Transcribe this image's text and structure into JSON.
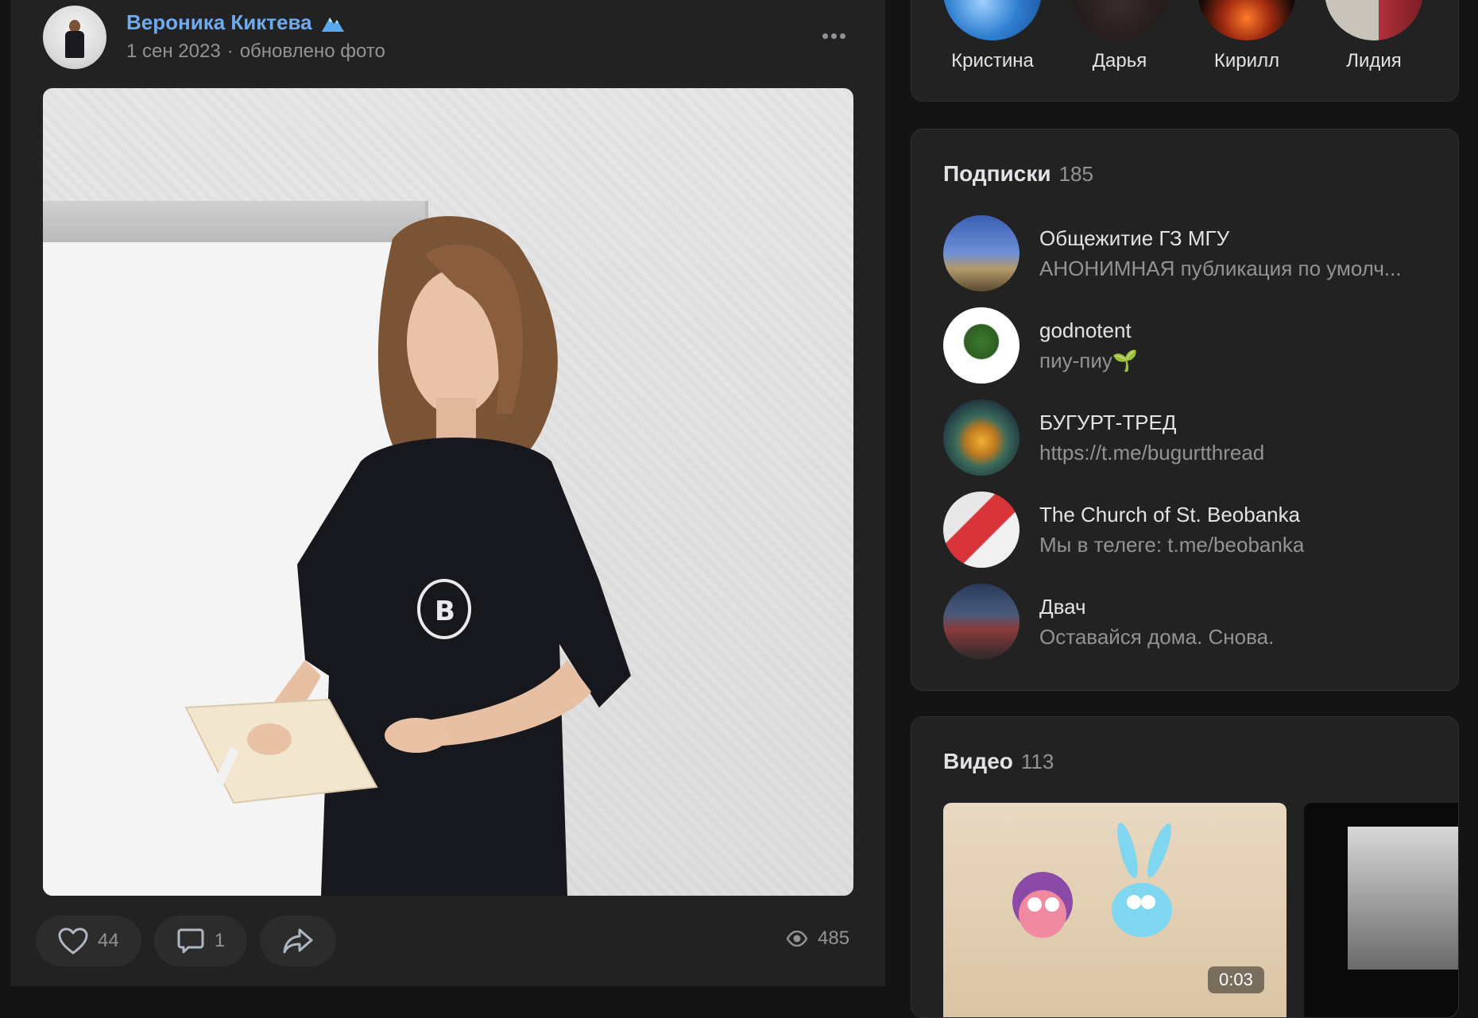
{
  "post": {
    "author": "Вероника Киктева",
    "date": "1 сен 2023",
    "separator": "·",
    "action": "обновлено фото",
    "likes": "44",
    "comments": "1",
    "views": "485"
  },
  "friends": [
    {
      "name": "Кристина"
    },
    {
      "name": "Дарья"
    },
    {
      "name": "Кирилл"
    },
    {
      "name": "Лидия"
    }
  ],
  "subscriptions": {
    "title": "Подписки",
    "count": "185",
    "items": [
      {
        "name": "Общежитие ГЗ МГУ",
        "desc": "АНОНИМНАЯ публикация по умолч..."
      },
      {
        "name": "godnotent",
        "desc": "пиу-пиу🌱"
      },
      {
        "name": "БУГУРТ-ТРЕД",
        "desc": "https://t.me/bugurtthread"
      },
      {
        "name": "The Church of St. Beobanka",
        "desc": "Мы в телеге: t.me/beobanka"
      },
      {
        "name": "Двач",
        "desc": "Оставайся дома. Снова."
      }
    ]
  },
  "videos": {
    "title": "Видео",
    "count": "113",
    "first_duration": "0:03"
  },
  "colors": {
    "background": "#141414",
    "card": "#222222",
    "link": "#71aaeb",
    "muted": "#939393",
    "text": "#e1e3e6"
  }
}
